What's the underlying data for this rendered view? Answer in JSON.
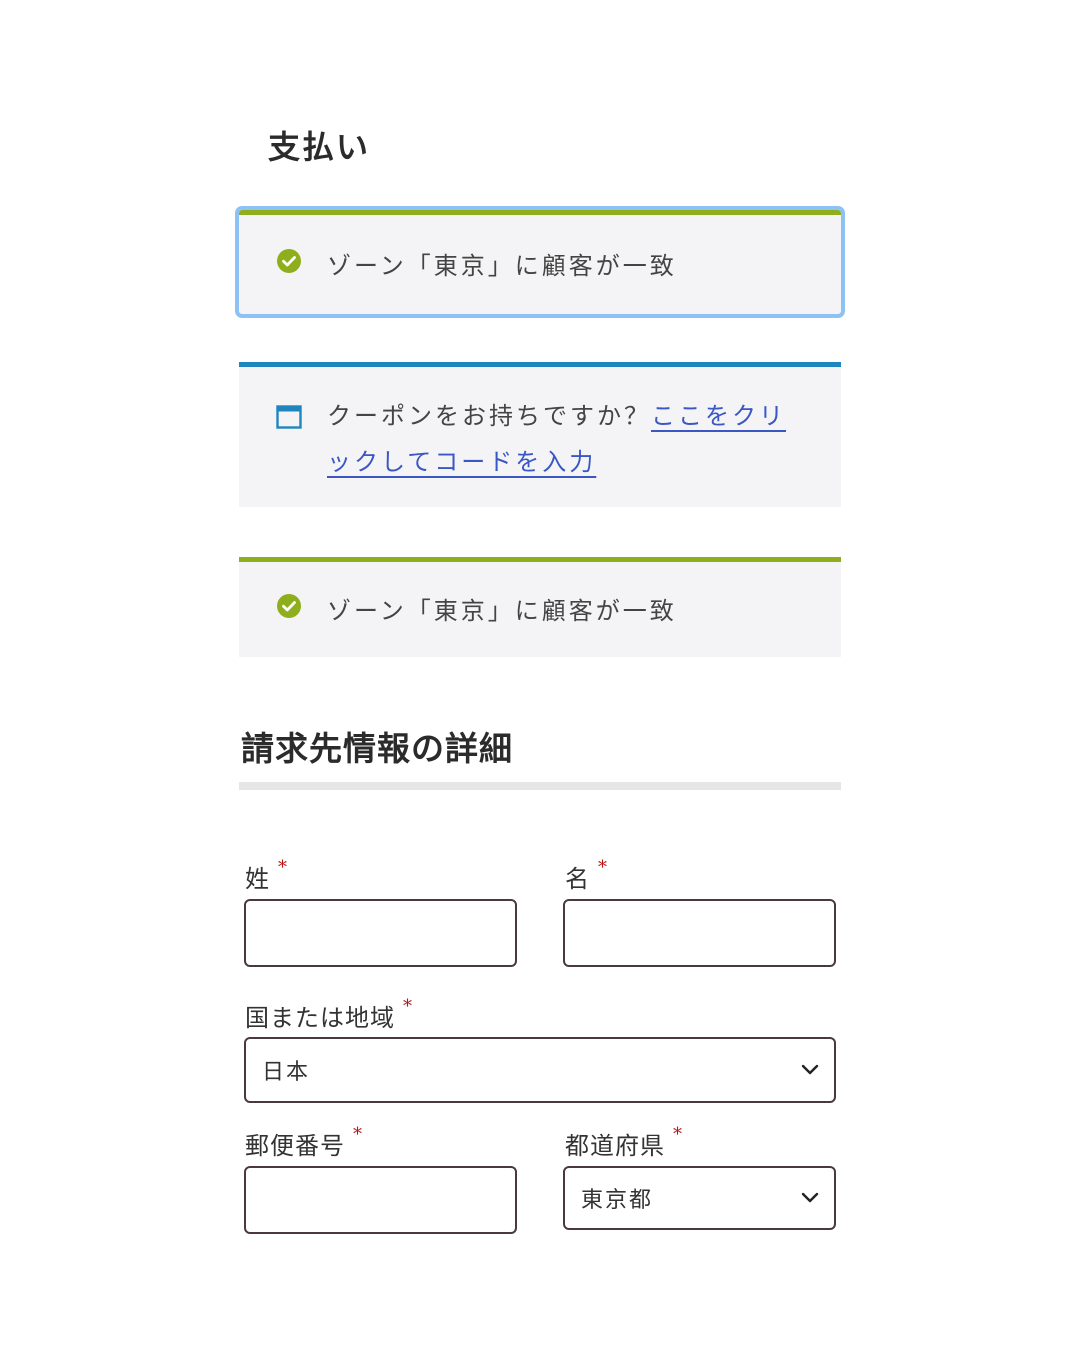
{
  "page": {
    "title": "支払い"
  },
  "notices": {
    "zone_match_1": "ゾーン「東京」に顧客が一致",
    "coupon_prompt": "クーポンをお持ちですか？",
    "coupon_link": "ここをクリックしてコードを入力",
    "zone_match_2": "ゾーン「東京」に顧客が一致"
  },
  "billing": {
    "title": "請求先情報の詳細",
    "required_mark": "*",
    "last_name": {
      "label": "姓",
      "value": ""
    },
    "first_name": {
      "label": "名",
      "value": ""
    },
    "country": {
      "label": "国または地域",
      "selected": "日本"
    },
    "postcode": {
      "label": "郵便番号",
      "value": ""
    },
    "prefecture": {
      "label": "都道府県",
      "selected": "東京都"
    }
  },
  "colors": {
    "success_accent": "#8fae1b",
    "info_accent": "#1e85be",
    "link": "#3b57c4",
    "required": "#b3151b",
    "focus_ring": "#8cc2f5"
  },
  "icons": {
    "success": "check-circle-icon",
    "coupon": "window-icon",
    "select": "chevron-down-icon"
  }
}
